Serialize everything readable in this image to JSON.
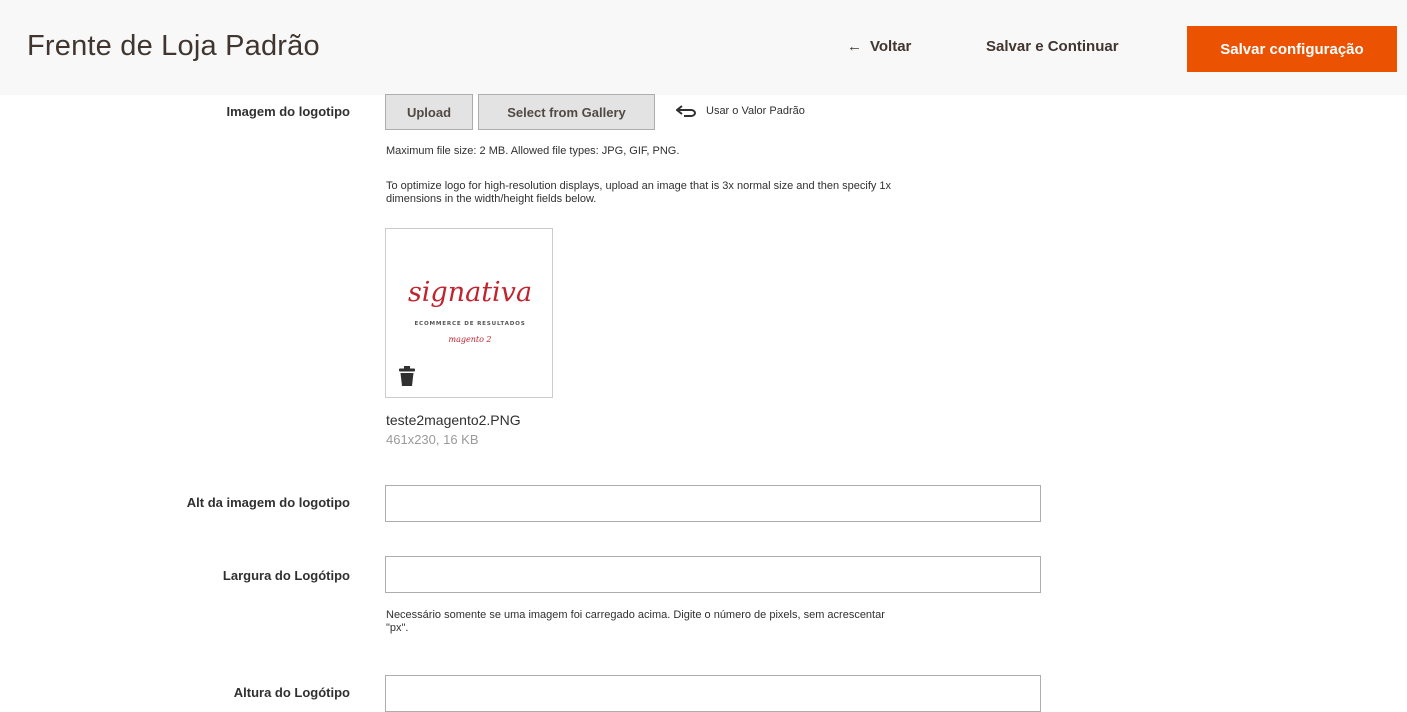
{
  "header": {
    "title": "Frente de Loja Padrão",
    "back_arrow": "←",
    "back_label": "Voltar",
    "save_continue_label": "Salvar e Continuar",
    "save_config_label": "Salvar configuração",
    "accent_color": "#eb5202"
  },
  "logo_field": {
    "label": "Imagem do logotipo",
    "upload_label": "Upload",
    "gallery_label": "Select from Gallery",
    "use_default_label": "Usar o Valor Padrão",
    "use_default_icon": "undo-arrow-icon",
    "note_max_size": "Maximum file size: 2 MB. Allowed file types: JPG, GIF, PNG.",
    "note_optimize_line1": "To optimize logo for high-resolution displays, upload an image that is 3x normal size and then specify 1x",
    "note_optimize_line2": "dimensions in the width/height fields below.",
    "preview": {
      "logo_word": "signativa",
      "logo_tagline": "ECOMMERCE DE RESULTADOS",
      "logo_sub": "magento 2",
      "delete_icon": "trash-icon"
    },
    "file_name": "teste2magento2.PNG",
    "file_meta": "461x230, 16 KB"
  },
  "alt_field": {
    "label": "Alt da imagem do logotipo",
    "value": ""
  },
  "width_field": {
    "label": "Largura do Logótipo",
    "value": "",
    "note_line1": "Necessário somente se uma imagem foi carregado acima. Digite o número de pixels, sem acrescentar",
    "note_line2": "\"px\"."
  },
  "height_field": {
    "label": "Altura do Logótipo",
    "value": ""
  }
}
